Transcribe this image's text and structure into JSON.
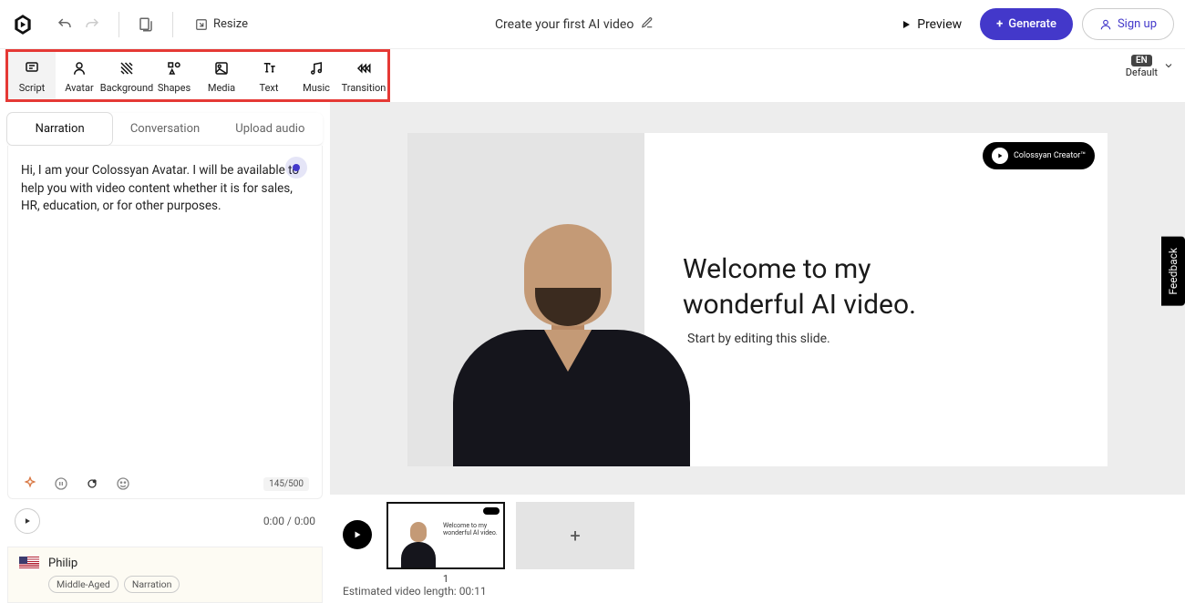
{
  "header": {
    "resize": "Resize",
    "title": "Create your first AI video",
    "preview": "Preview",
    "generate": "Generate",
    "signup": "Sign up",
    "language_code": "EN",
    "language_label": "Default"
  },
  "toolbar": {
    "items": [
      {
        "label": "Script"
      },
      {
        "label": "Avatar"
      },
      {
        "label": "Background"
      },
      {
        "label": "Shapes"
      },
      {
        "label": "Media"
      },
      {
        "label": "Text"
      },
      {
        "label": "Music"
      },
      {
        "label": "Transition"
      }
    ]
  },
  "tabs": {
    "narration": "Narration",
    "conversation": "Conversation",
    "upload": "Upload audio"
  },
  "script": {
    "text": "Hi, I am your Colossyan Avatar. I will be available to help you with video content whether it is for sales, HR, education, or for other purposes.",
    "counter": "145/500"
  },
  "playback": {
    "time": "0:00 / 0:00"
  },
  "voice": {
    "name": "Philip",
    "tag1": "Middle-Aged",
    "tag2": "Narration"
  },
  "slide": {
    "title_line1": "Welcome to my",
    "title_line2": "wonderful AI video.",
    "subtitle": "Start by editing this slide.",
    "brand": "Colossyan Creator™"
  },
  "timeline": {
    "thumb_text1": "Welcome to my",
    "thumb_text2": "wonderful AI video.",
    "thumb_num": "1",
    "estimated": "Estimated video length: 00:11"
  },
  "feedback": "Feedback"
}
